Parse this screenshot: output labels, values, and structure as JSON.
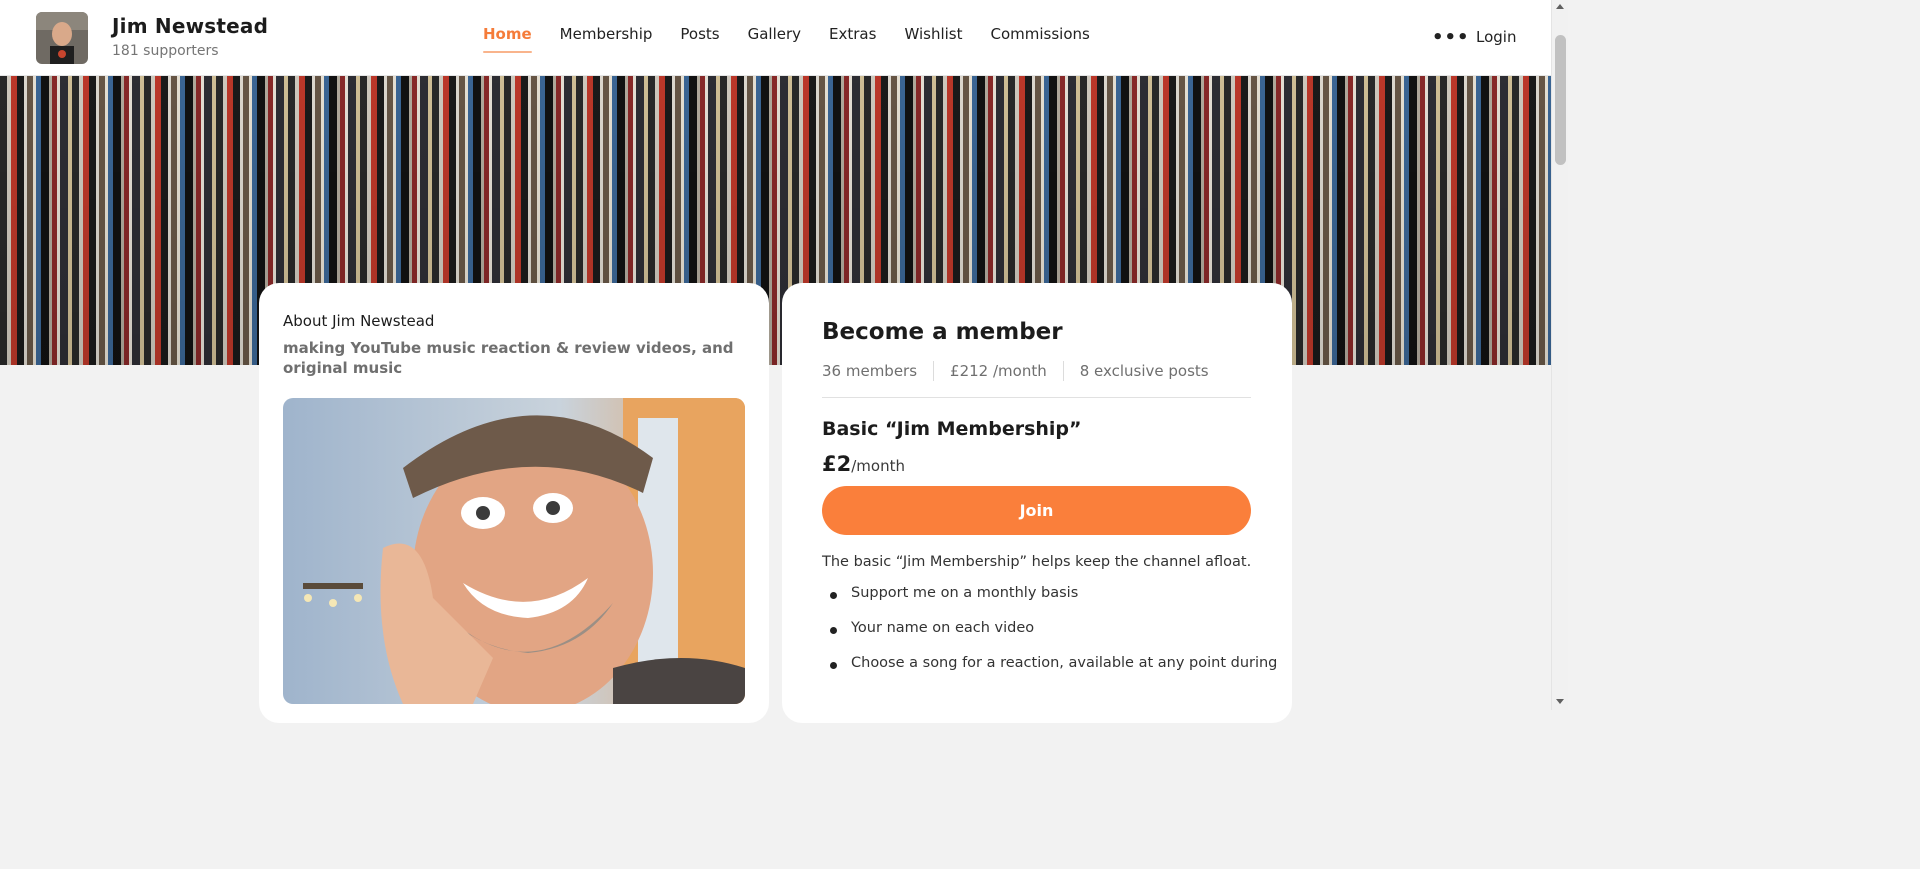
{
  "creator": {
    "name": "Jim Newstead",
    "supporters": "181 supporters"
  },
  "nav": {
    "items": [
      {
        "label": "Home",
        "active": true
      },
      {
        "label": "Membership"
      },
      {
        "label": "Posts"
      },
      {
        "label": "Gallery"
      },
      {
        "label": "Extras"
      },
      {
        "label": "Wishlist"
      },
      {
        "label": "Commissions"
      }
    ],
    "more_icon": "more-dots-icon",
    "more_glyph": "•••",
    "login": "Login"
  },
  "about": {
    "title": "About Jim Newstead",
    "description": "making YouTube music reaction & review videos, and original music"
  },
  "membership": {
    "title": "Become a member",
    "stats": [
      "36 members",
      "£212 /month",
      "8 exclusive posts"
    ],
    "tier": {
      "name": "Basic “Jim Membership”",
      "price": "£2",
      "period": "/month",
      "join_label": "Join",
      "description": "The basic “Jim Membership” helps keep the channel afloat.",
      "benefits": [
        "Support me on a monthly basis",
        "Your name on each video",
        "Choose a song for a reaction, available at any point during"
      ]
    }
  },
  "colors": {
    "accent": "#fa7f3b",
    "nav_active": "#f57c3a"
  }
}
